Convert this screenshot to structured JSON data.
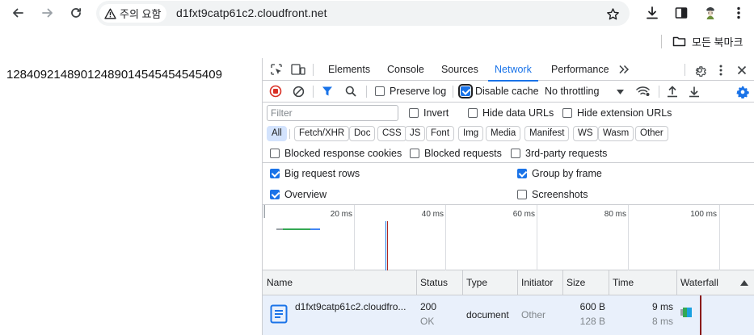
{
  "browser": {
    "security_label": "주의 요함",
    "url": "d1fxt9catp61c2.cloudfront.net",
    "bookmarks_folder": "모든 북마크"
  },
  "page": {
    "content_text": "12840921489012489014545454545409"
  },
  "devtools": {
    "tabs": [
      "Elements",
      "Console",
      "Sources",
      "Network",
      "Performance"
    ],
    "active_tab": "Network",
    "toolbar": {
      "preserve_log": "Preserve log",
      "disable_cache": "Disable cache",
      "throttling": "No throttling"
    },
    "filter": {
      "placeholder": "Filter",
      "invert": "Invert",
      "hide_data_urls": "Hide data URLs",
      "hide_extension_urls": "Hide extension URLs"
    },
    "type_filters": [
      "All",
      "Fetch/XHR",
      "Doc",
      "CSS",
      "JS",
      "Font",
      "Img",
      "Media",
      "Manifest",
      "WS",
      "Wasm",
      "Other"
    ],
    "blocked": {
      "blocked_response_cookies": "Blocked response cookies",
      "blocked_requests": "Blocked requests",
      "third_party_requests": "3rd-party requests"
    },
    "settings": {
      "big_request_rows": "Big request rows",
      "group_by_frame": "Group by frame",
      "overview": "Overview",
      "screenshots": "Screenshots"
    },
    "overview_ticks": [
      "20 ms",
      "40 ms",
      "60 ms",
      "80 ms",
      "100 ms"
    ],
    "table": {
      "columns": {
        "name": "Name",
        "status": "Status",
        "type": "Type",
        "initiator": "Initiator",
        "size": "Size",
        "time": "Time",
        "waterfall": "Waterfall"
      },
      "rows": [
        {
          "name": "d1fxt9catp61c2.cloudfro...",
          "status_code": "200",
          "status_text": "OK",
          "type": "document",
          "initiator": "Other",
          "size_transferred": "600 B",
          "size_resource": "128 B",
          "time_total": "9 ms",
          "time_latency": "8 ms"
        }
      ]
    }
  },
  "colors": {
    "accent": "#1a73e8",
    "record_red": "#d93025",
    "doc_icon": "#1a73e8"
  }
}
